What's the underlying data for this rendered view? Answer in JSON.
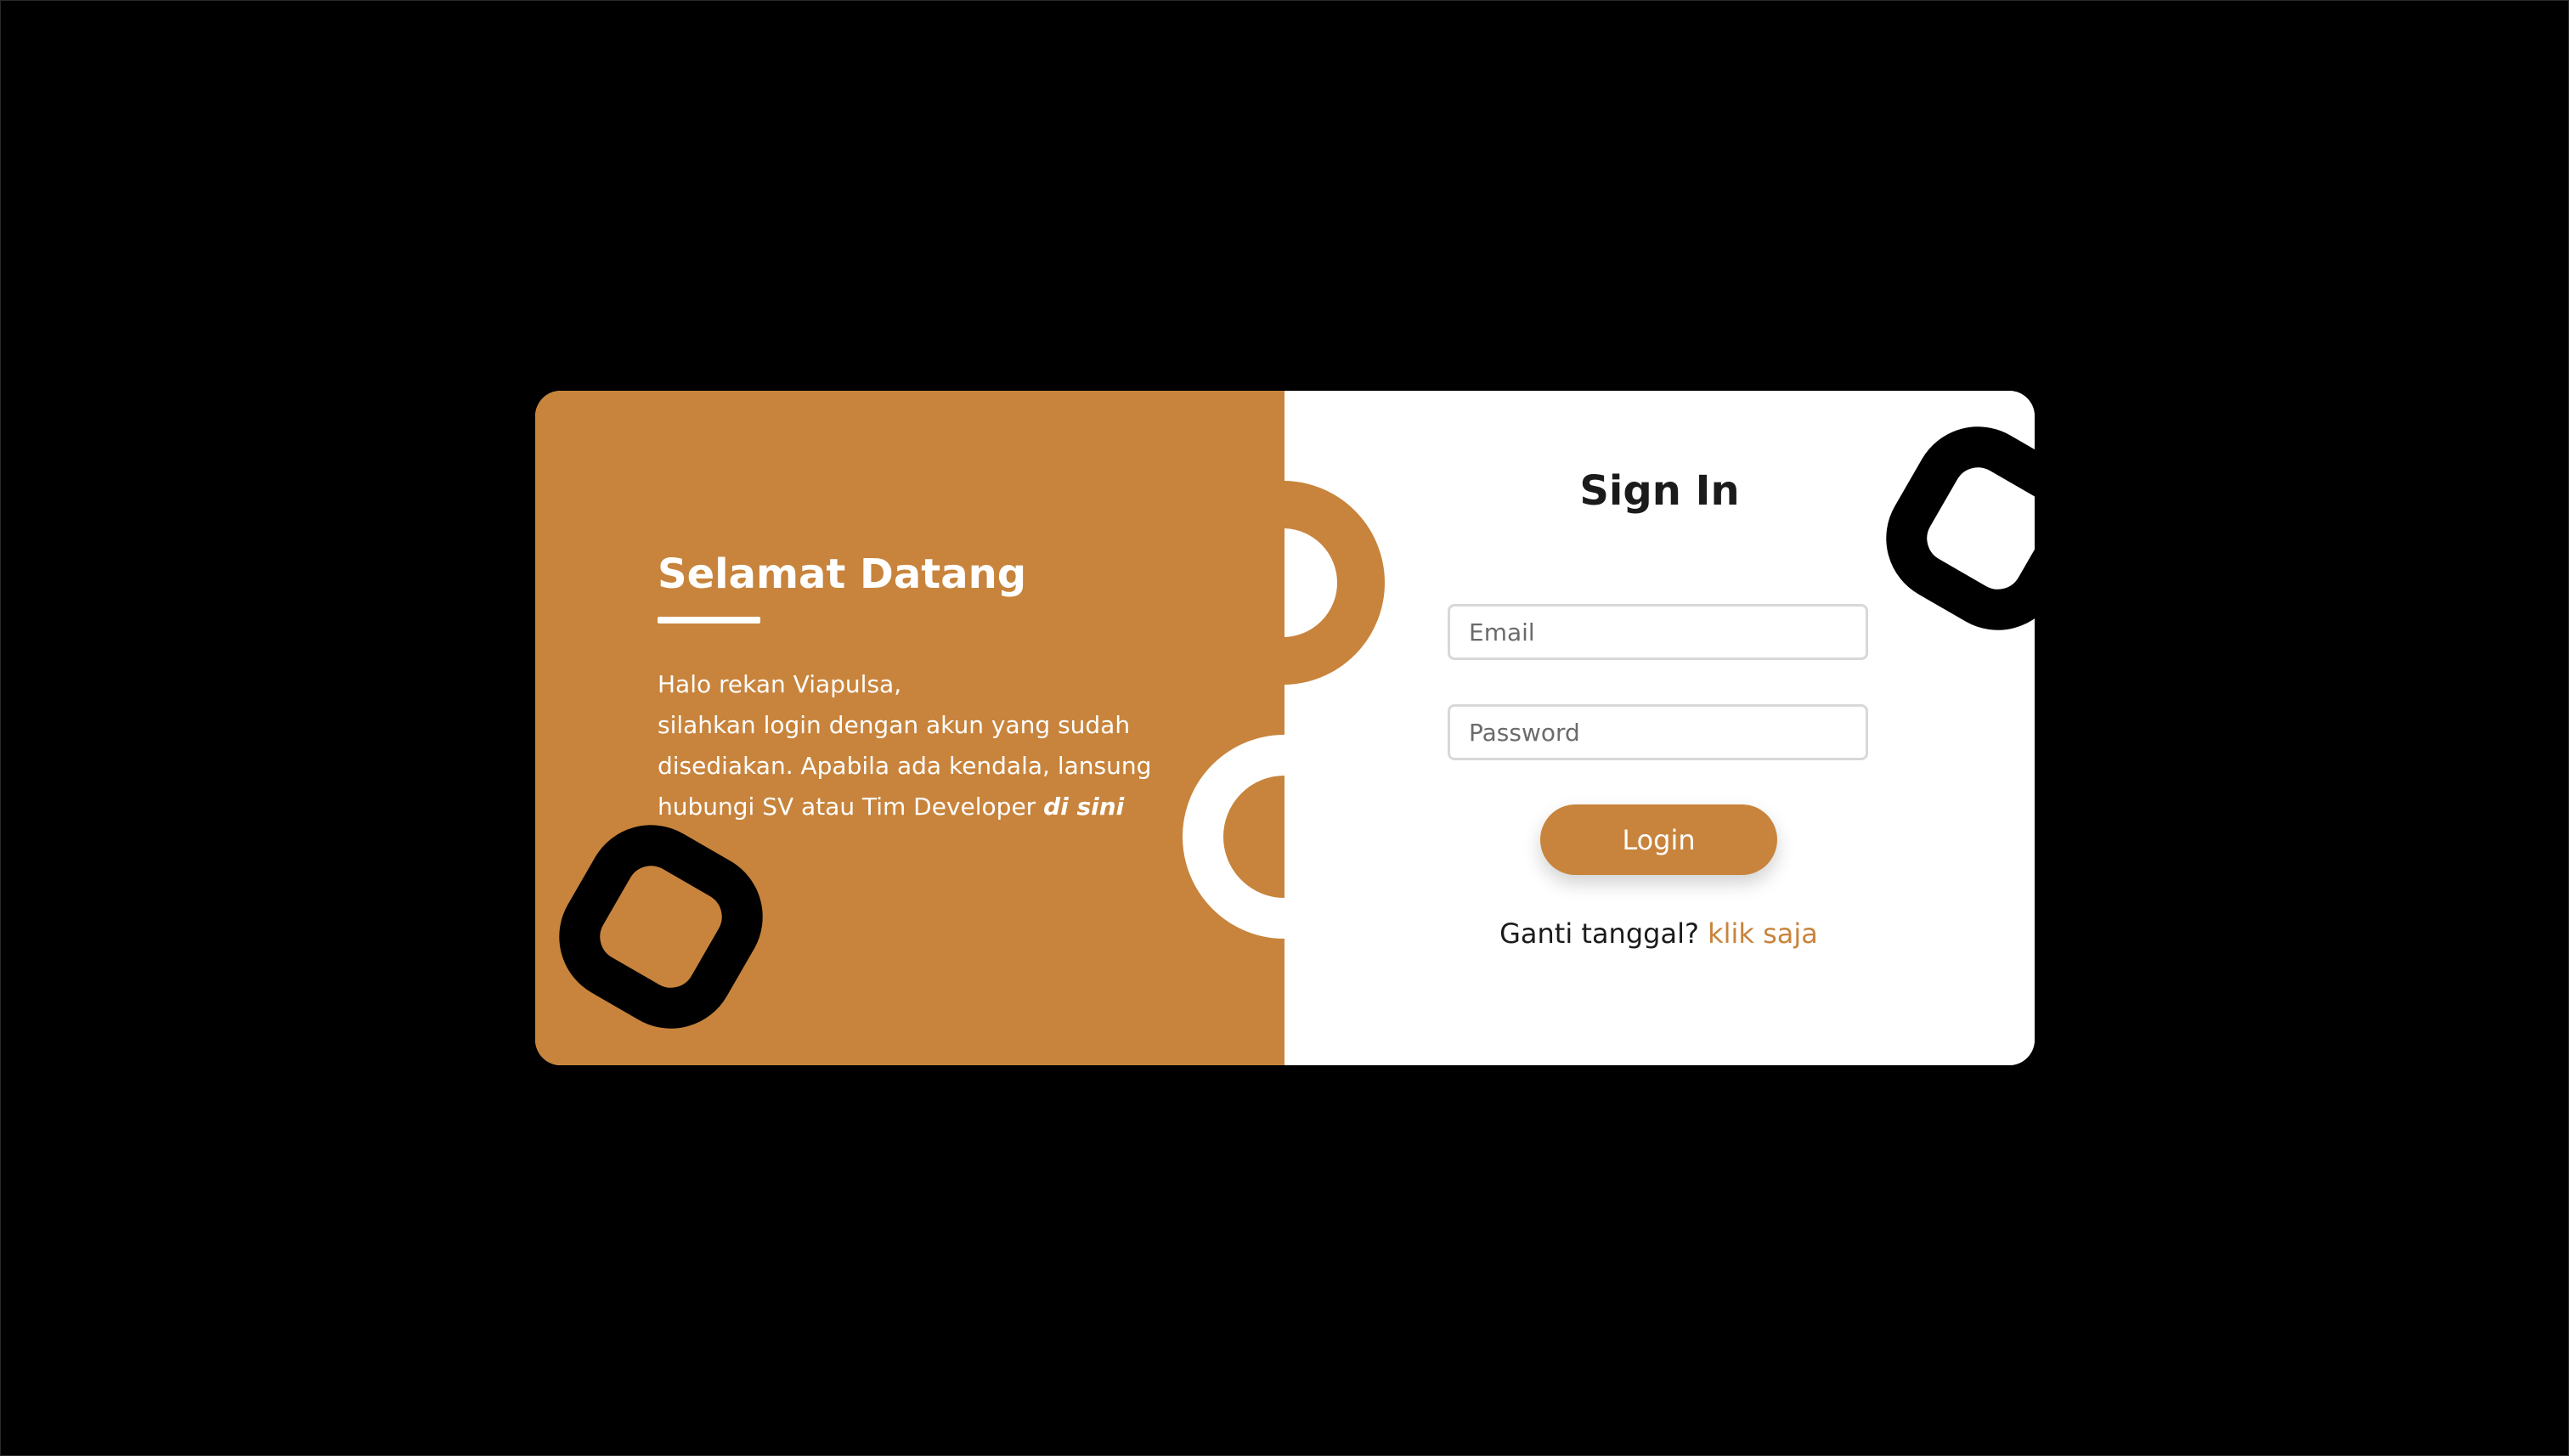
{
  "welcome": {
    "title": "Selamat Datang",
    "line1": "Halo rekan Viapulsa,",
    "line2": "silahkan login dengan akun yang sudah",
    "line3": "disediakan. Apabila ada kendala, lansung",
    "line4_prefix": "hubungi SV atau Tim Developer ",
    "line4_link": "di sini"
  },
  "signin": {
    "title": "Sign In",
    "email_placeholder": "Email",
    "password_placeholder": "Password",
    "login_label": "Login",
    "alt_prompt": "Ganti tanggal?",
    "alt_link": "klik saja"
  },
  "colors": {
    "accent": "#c8843c",
    "background": "#000000",
    "card": "#ffffff"
  }
}
